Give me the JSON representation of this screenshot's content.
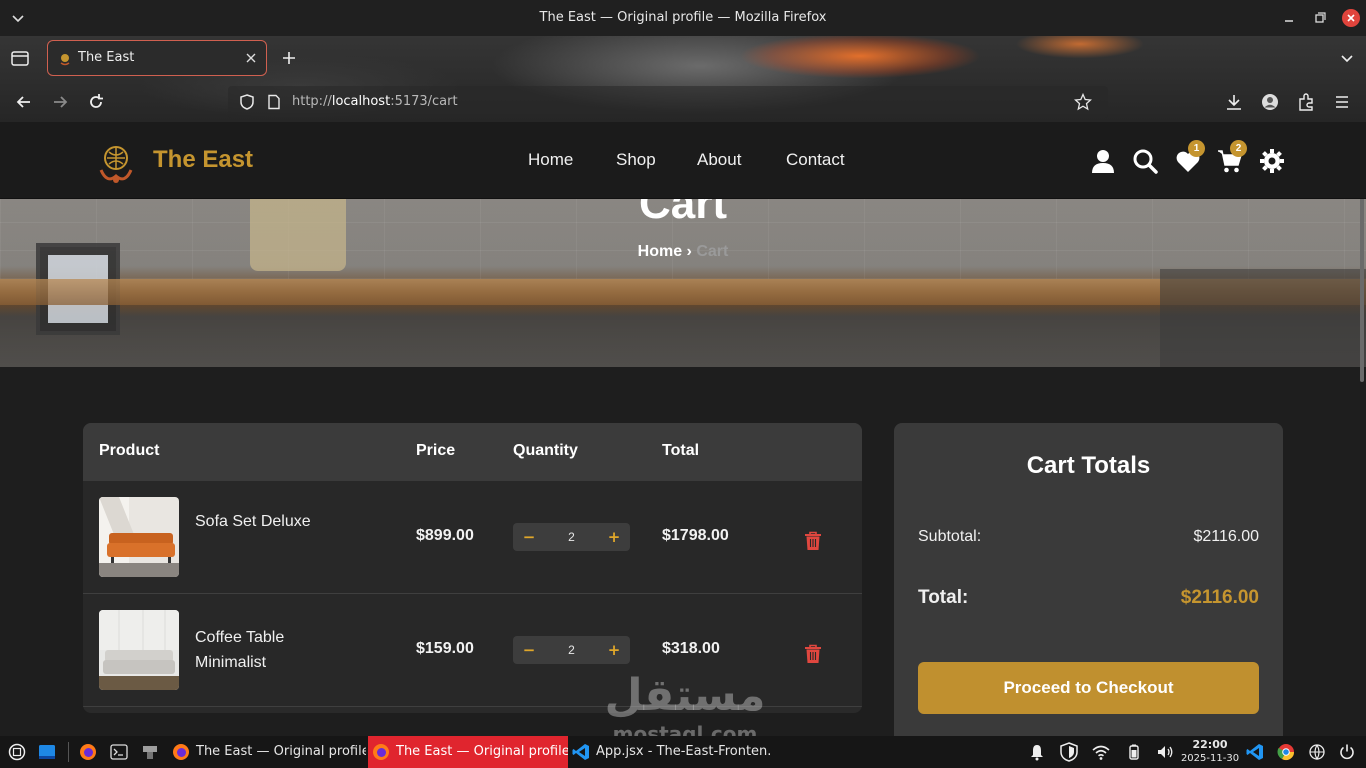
{
  "window": {
    "title": "The East — Original profile — Mozilla Firefox"
  },
  "browser": {
    "tab_title": "The East",
    "url_prefix": "http://",
    "url_host": "localhost",
    "url_rest": ":5173/cart"
  },
  "site": {
    "brand": "The East",
    "nav": [
      "Home",
      "Shop",
      "About",
      "Contact"
    ],
    "wishlist_count": "1",
    "cart_count": "2",
    "accent_color": "#c5952f"
  },
  "hero": {
    "title": "Cart",
    "breadcrumb_home": "Home",
    "breadcrumb_sep": "›",
    "breadcrumb_current": "Cart"
  },
  "cart": {
    "headers": {
      "product": "Product",
      "price": "Price",
      "quantity": "Quantity",
      "total": "Total"
    },
    "items": [
      {
        "name": "Sofa Set Deluxe",
        "price": "$899.00",
        "qty": "2",
        "total": "$1798.00",
        "minus": "−",
        "plus": "+"
      },
      {
        "name": "Coffee Table Minimalist",
        "price": "$159.00",
        "qty": "2",
        "total": "$318.00",
        "minus": "−",
        "plus": "+"
      }
    ]
  },
  "totals": {
    "heading": "Cart Totals",
    "subtotal_label": "Subtotal:",
    "subtotal_value": "$2116.00",
    "total_label": "Total:",
    "total_value": "$2116.00",
    "checkout_label": "Proceed to Checkout"
  },
  "watermark": {
    "arabic": "مستقل",
    "latin": "mostaql.com"
  },
  "taskbar": {
    "tasks": [
      "The East — Original profile...",
      "The East — Original profile...",
      "App.jsx - The-East-Fronten..."
    ],
    "time": "22:00",
    "date": "2025-11-30"
  }
}
